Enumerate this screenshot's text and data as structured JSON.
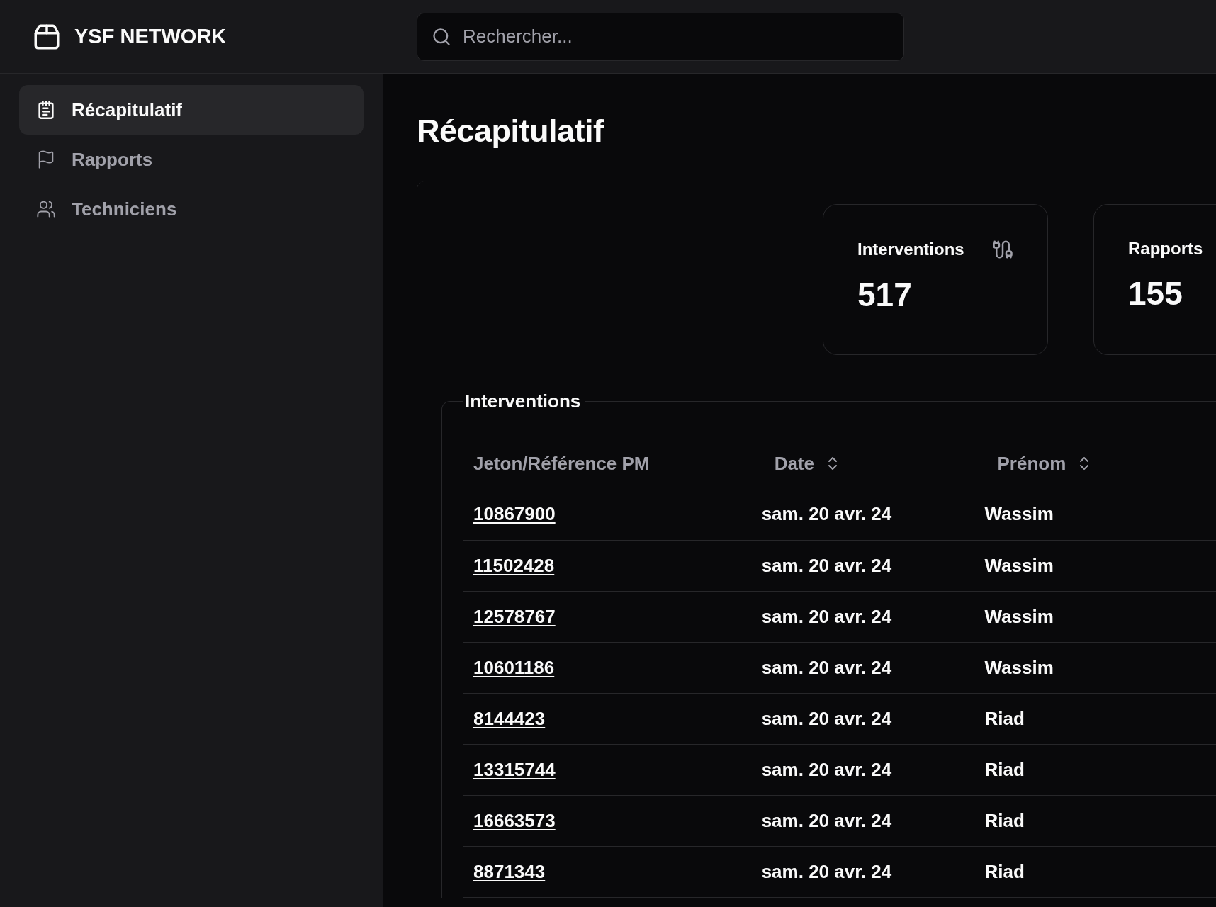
{
  "brand": {
    "name": "YSF NETWORK"
  },
  "sidebar": {
    "items": [
      {
        "label": "Récapitulatif",
        "selected": true
      },
      {
        "label": "Rapports",
        "selected": false
      },
      {
        "label": "Techniciens",
        "selected": false
      }
    ]
  },
  "search": {
    "placeholder": "Rechercher..."
  },
  "page_title": "Récapitulatif",
  "stats": [
    {
      "label": "Interventions",
      "value": "517",
      "has_icon": true
    },
    {
      "label": "Rapports",
      "value": "155",
      "has_icon": false
    }
  ],
  "table": {
    "title": "Interventions",
    "columns": [
      {
        "label": "Jeton/Référence PM",
        "sortable": false
      },
      {
        "label": "Date",
        "sortable": true
      },
      {
        "label": "Prénom",
        "sortable": true
      }
    ],
    "rows": [
      [
        "10867900",
        "sam. 20 avr. 24",
        "Wassim"
      ],
      [
        "11502428",
        "sam. 20 avr. 24",
        "Wassim"
      ],
      [
        "12578767",
        "sam. 20 avr. 24",
        "Wassim"
      ],
      [
        "10601186",
        "sam. 20 avr. 24",
        "Wassim"
      ],
      [
        "8144423",
        "sam. 20 avr. 24",
        "Riad"
      ],
      [
        "13315744",
        "sam. 20 avr. 24",
        "Riad"
      ],
      [
        "16663573",
        "sam. 20 avr. 24",
        "Riad"
      ],
      [
        "8871343",
        "sam. 20 avr. 24",
        "Riad"
      ]
    ]
  }
}
